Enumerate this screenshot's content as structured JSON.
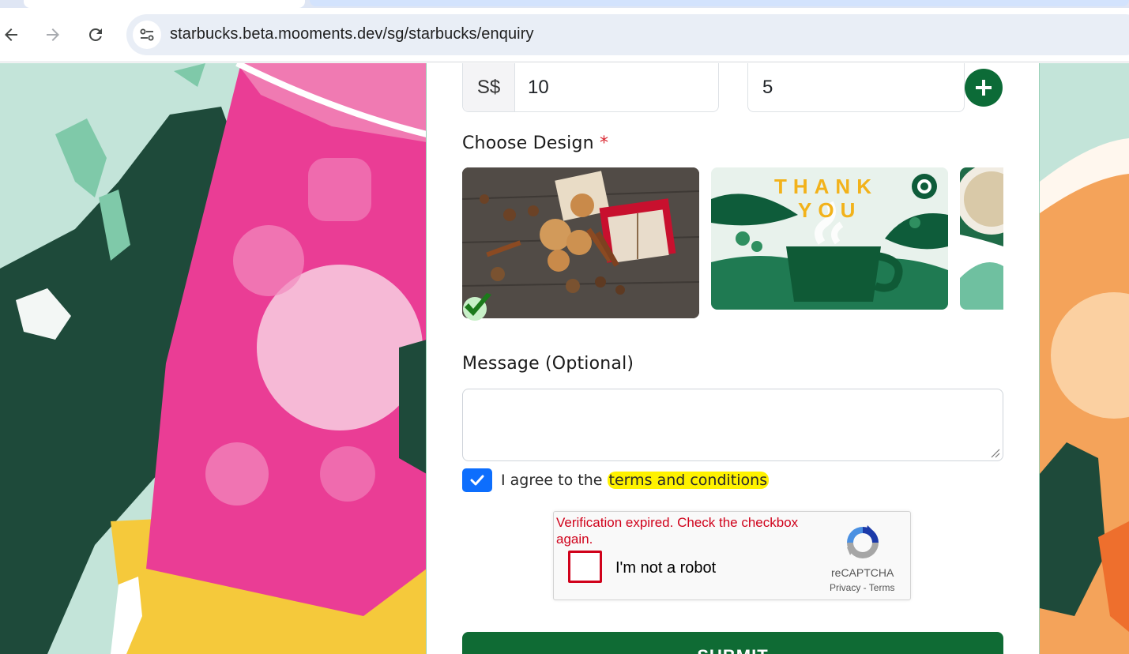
{
  "browser": {
    "url": "starbucks.beta.mooments.dev/sg/starbucks/enquiry",
    "icons": [
      "back-icon",
      "forward-icon",
      "reload-icon",
      "site-info-icon"
    ]
  },
  "form": {
    "currency": "S$",
    "amount_value": "10",
    "quantity_value": "5",
    "design_label": "Choose Design",
    "required_marker": "*",
    "designs": [
      {
        "name": "gingerbread-spice-design",
        "selected": true
      },
      {
        "name": "thank-you-design",
        "text_line1": "THANK",
        "text_line2": "YOU",
        "selected": false
      },
      {
        "name": "coffee-design-partial",
        "selected": false
      }
    ],
    "message_label": "Message (Optional)",
    "message_value": "",
    "agree_prefix": "I agree to the ",
    "terms_link": "terms and conditions",
    "agree_checked": true,
    "submit_label": "SUBMIT"
  },
  "recaptcha": {
    "error": "Verification expired. Check the checkbox again.",
    "label": "I'm not a robot",
    "brand": "reCAPTCHA",
    "privacy": "Privacy",
    "separator": " - ",
    "terms": "Terms"
  },
  "colors": {
    "brand_green": "#0f6b34",
    "checkbox_blue": "#0d6efd",
    "error_red": "#d0021b",
    "highlight_yellow": "#fff200"
  }
}
